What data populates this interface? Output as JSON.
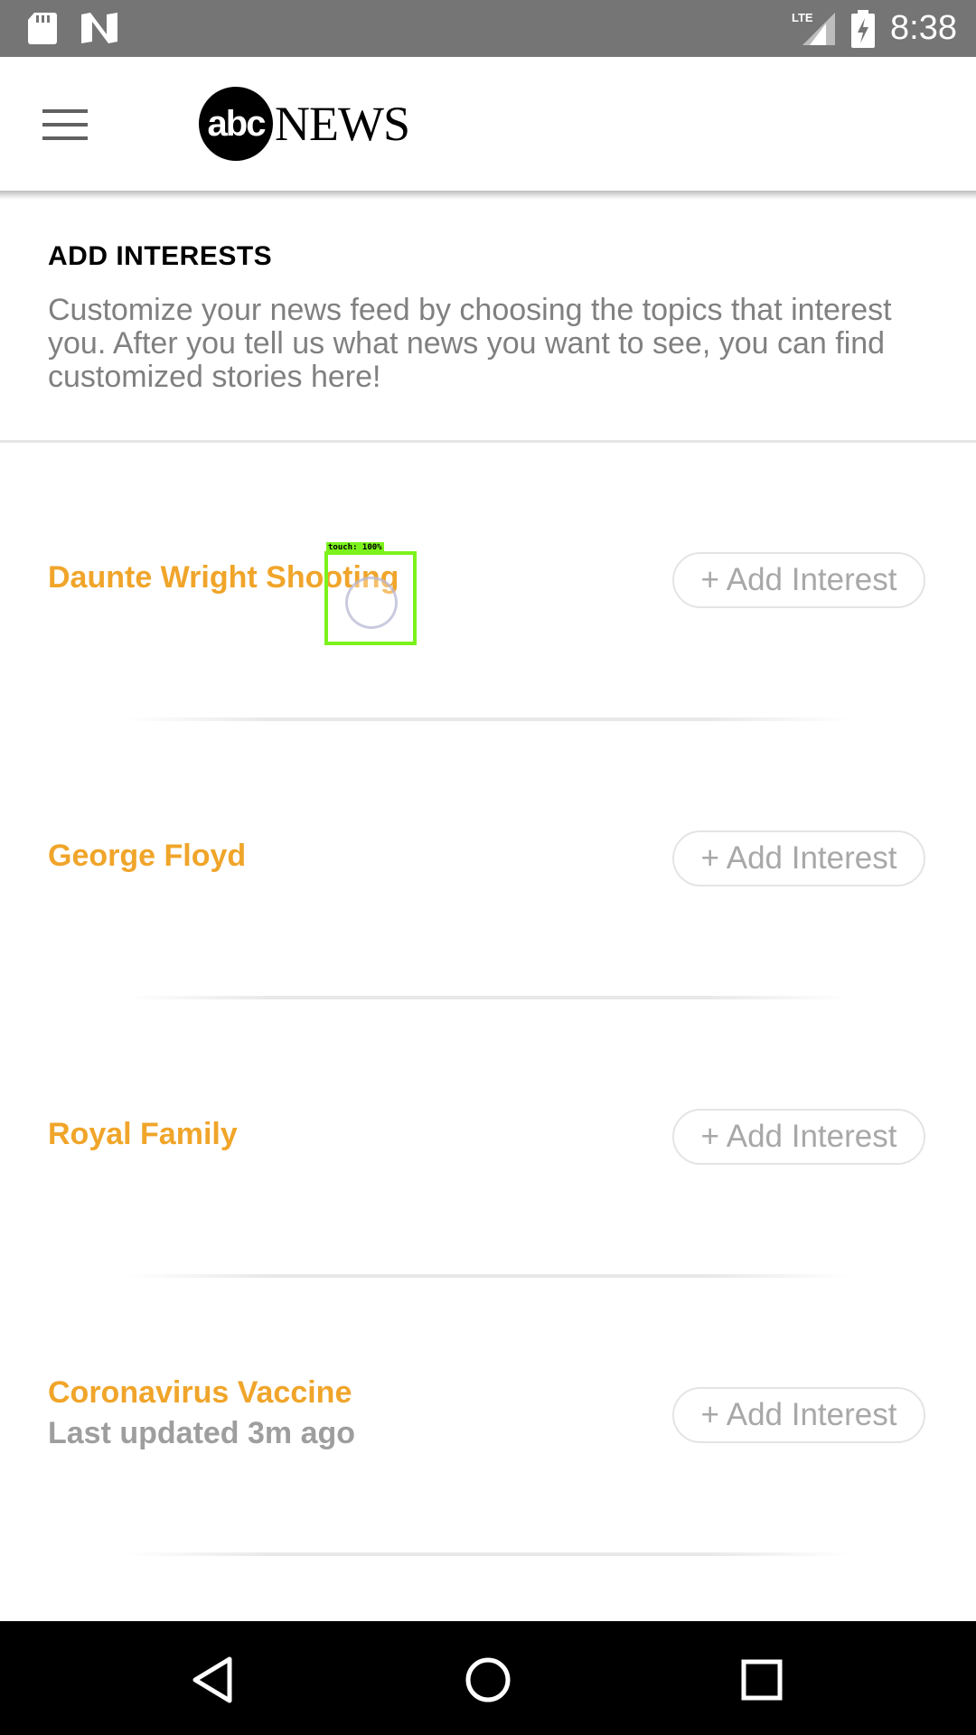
{
  "status_bar": {
    "time": "8:38",
    "network": "LTE",
    "icons": [
      "sd-card-icon",
      "n-notification-icon",
      "lte-signal-icon",
      "battery-charging-icon"
    ]
  },
  "app_bar": {
    "logo_mark": "abc",
    "logo_word": "NEWS",
    "menu_icon": "hamburger-menu-icon"
  },
  "intro": {
    "title": "ADD INTERESTS",
    "description": "Customize your news feed by choosing the topics that interest you. After you tell us what news you want to see, you can find customized stories here!"
  },
  "interests": [
    {
      "name": "Daunte Wright Shooting",
      "subtitle": "",
      "button": "+ Add Interest"
    },
    {
      "name": "George Floyd",
      "subtitle": "",
      "button": "+ Add Interest"
    },
    {
      "name": "Royal Family",
      "subtitle": "",
      "button": "+ Add Interest"
    },
    {
      "name": "Coronavirus Vaccine",
      "subtitle": "Last updated 3m ago",
      "button": "+ Add Interest"
    }
  ],
  "touch_indicator": {
    "label": "touch: 100%"
  },
  "colors": {
    "status_bar": "#757575",
    "interest_name": "#f0a52a",
    "subtitle": "#9e9e9e",
    "button_text": "#a8a8a8",
    "touch_box": "#7cf21c",
    "nav_bar": "#000000"
  },
  "nav_bar": {
    "icons": [
      "back-icon",
      "home-icon",
      "recents-icon"
    ]
  }
}
